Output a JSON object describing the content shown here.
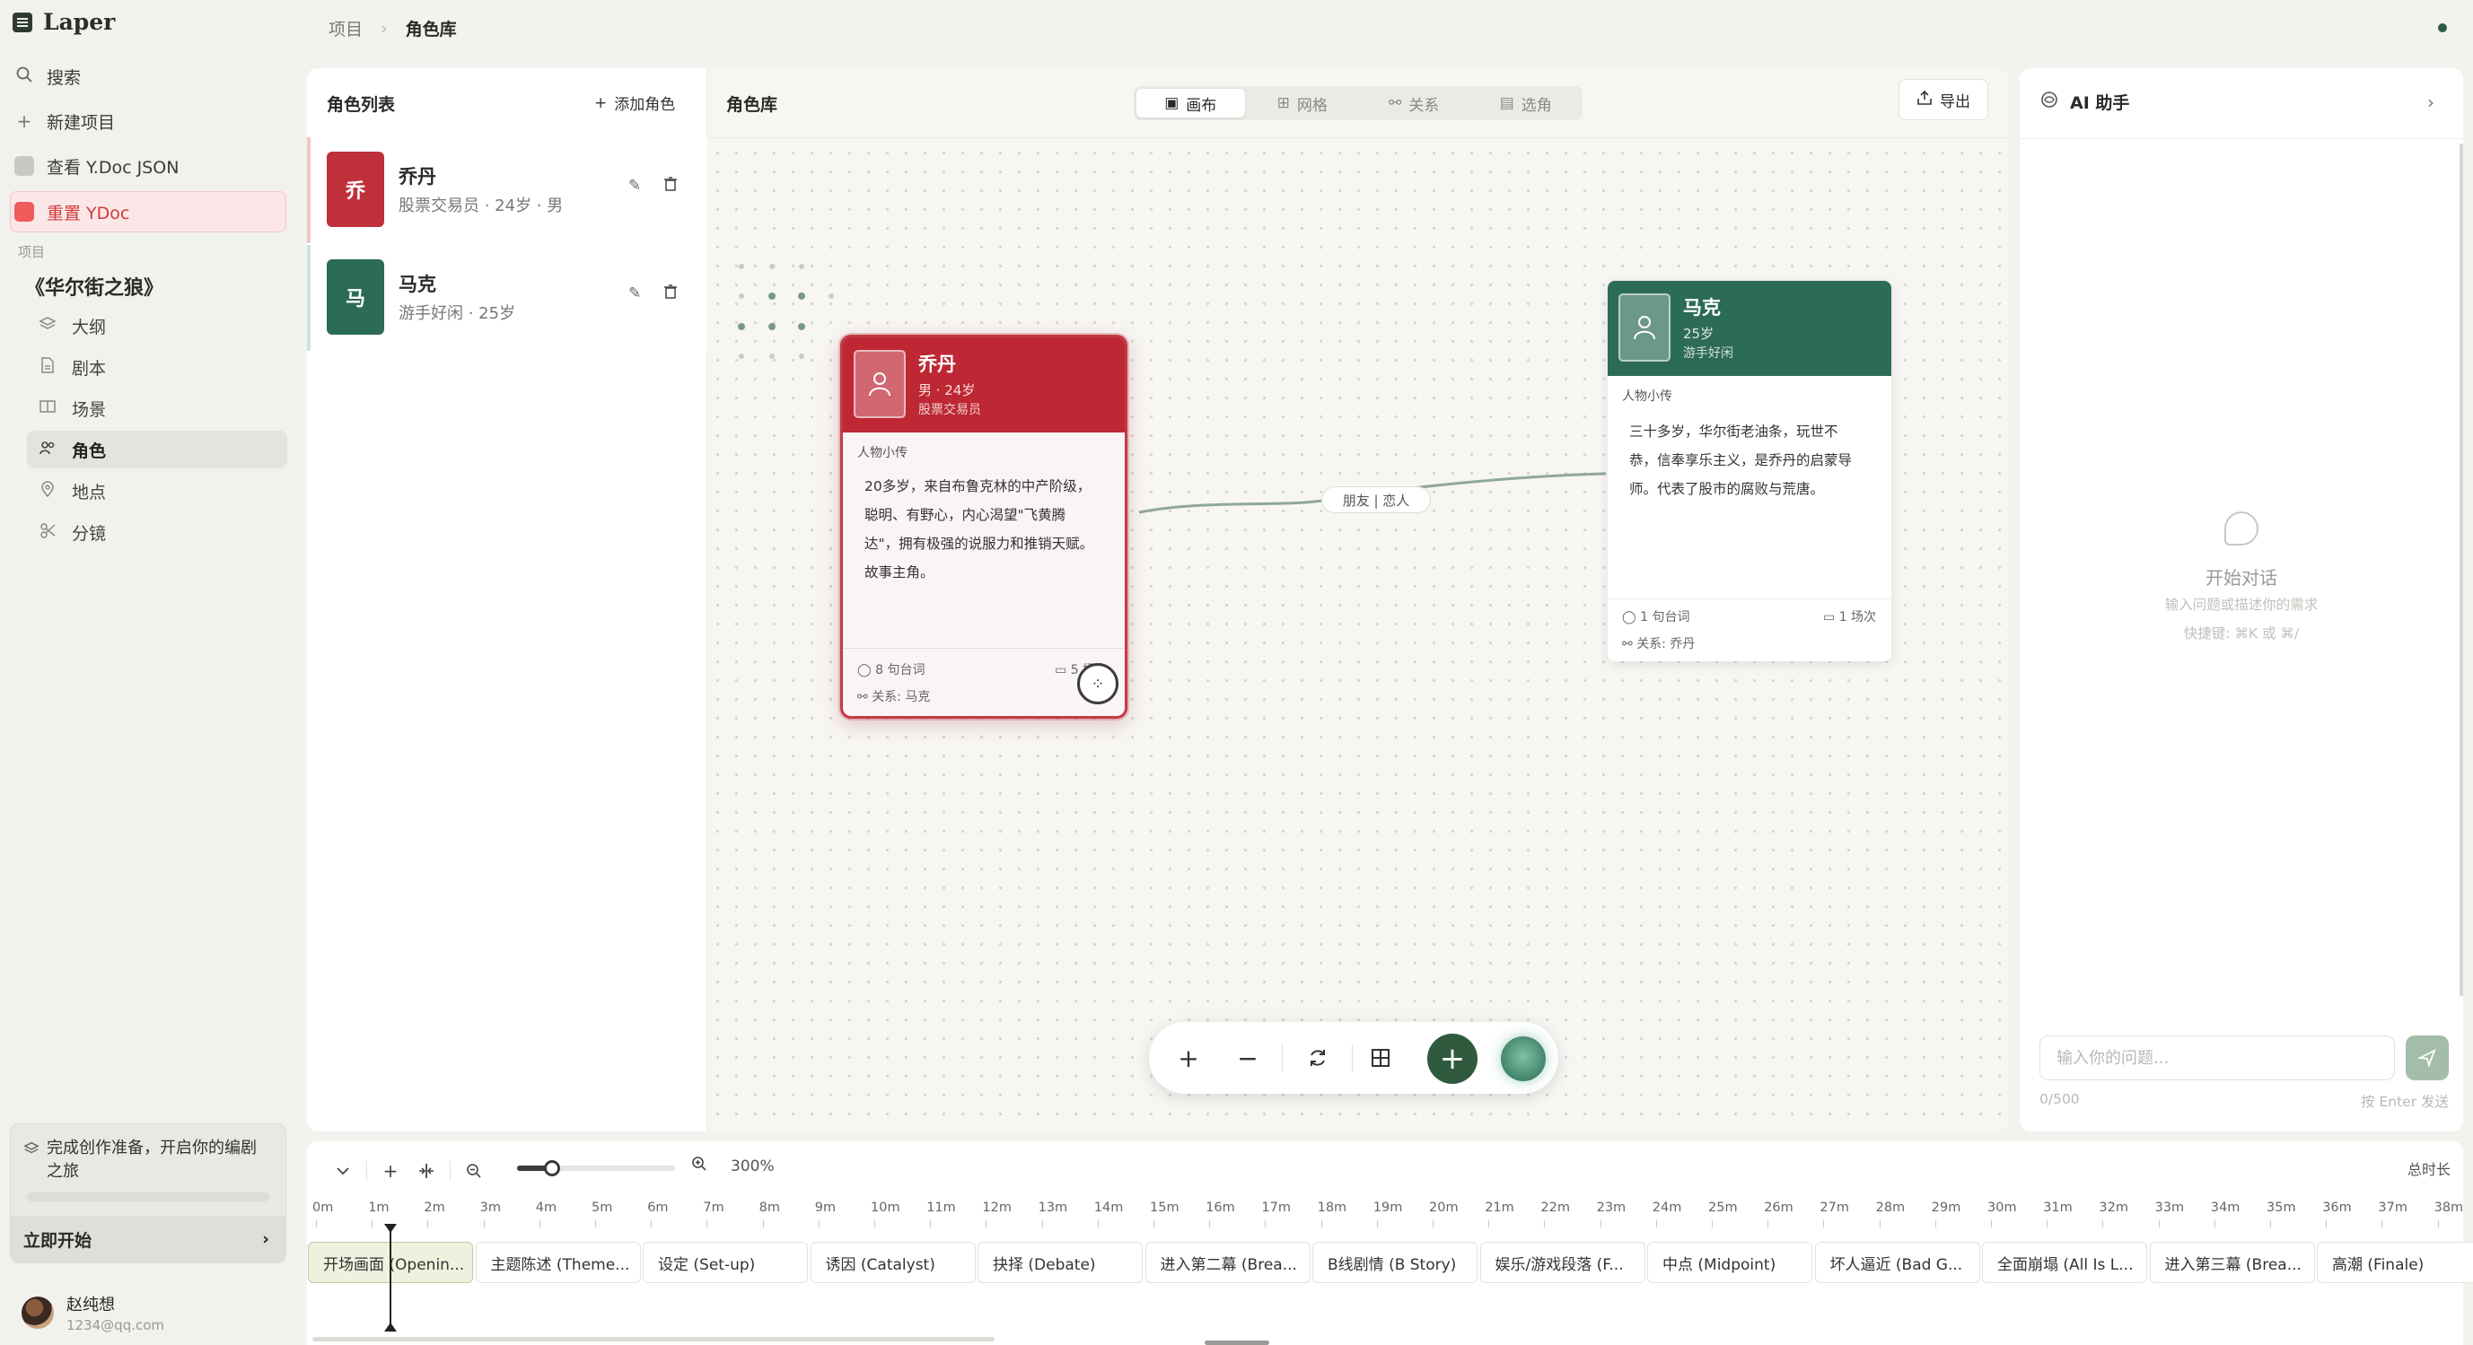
{
  "app": {
    "name": "Laper"
  },
  "sidebar": {
    "search": "搜索",
    "new_project": "新建项目",
    "view_ydoc": "查看 Y.Doc JSON",
    "reset_ydoc": "重置 YDoc",
    "section_label": "项目",
    "project_title": "《华尔街之狼》",
    "nav": [
      {
        "label": "大纲",
        "icon": "layers-icon"
      },
      {
        "label": "剧本",
        "icon": "file-icon"
      },
      {
        "label": "场景",
        "icon": "film-icon"
      },
      {
        "label": "角色",
        "icon": "users-icon"
      },
      {
        "label": "地点",
        "icon": "map-pin-icon"
      },
      {
        "label": "分镜",
        "icon": "storyboard-icon"
      }
    ],
    "tip": {
      "text": "完成创作准备，开启你的编剧之旅",
      "start": "立即开始"
    },
    "user": {
      "name": "赵纯想",
      "email": "1234@qq.com"
    }
  },
  "breadcrumb": {
    "root": "项目",
    "current": "角色库"
  },
  "list_panel": {
    "title": "角色列表",
    "add_label": "添加角色",
    "characters": [
      {
        "avatar": "乔",
        "name": "乔丹",
        "job": "股票交易员",
        "age": "24岁",
        "gender": "男",
        "color": "#c0303a"
      },
      {
        "avatar": "马",
        "name": "马克",
        "job": "游手好闲",
        "age": "25岁",
        "color": "#2d6b59"
      }
    ]
  },
  "canvas": {
    "title": "角色库",
    "tabs": [
      "画布",
      "网格",
      "关系",
      "选角"
    ],
    "active_tab": "画布",
    "export": "导出",
    "cards": {
      "jordan": {
        "name": "乔丹",
        "sub": "男 · 24岁",
        "job": "股票交易员",
        "bio_label": "人物小传",
        "bio": [
          "20多岁，来自布鲁克林的中产阶级，",
          "聪明、有野心，内心渴望\"飞黄腾",
          "达\"，拥有极强的说服力和推销天赋。",
          "故事主角。"
        ],
        "lines": "8 句台词",
        "scenes": "5 场次",
        "relation": "关系: 马克"
      },
      "mark": {
        "name": "马克",
        "age": "25岁",
        "job": "游手好闲",
        "bio_label": "人物小传",
        "bio": [
          "三十多岁，华尔街老油条，玩世不",
          "恭，信奉享乐主义，是乔丹的启蒙导",
          "师。代表了股市的腐败与荒唐。"
        ],
        "lines": "1 句台词",
        "scenes": "1 场次",
        "relation": "关系: 乔丹"
      }
    },
    "edge_label": "朋友 | 恋人"
  },
  "ai": {
    "title": "AI 助手",
    "empty_title": "开始对话",
    "empty_sub": "输入问题或描述你的需求",
    "shortcut": "快捷键: ⌘K 或 ⌘/",
    "placeholder": "输入你的问题...",
    "count": "0/500",
    "enter_hint": "按 Enter 发送"
  },
  "timeline": {
    "zoom": "300%",
    "total": "总时长",
    "ticks": [
      "0m",
      "1m",
      "2m",
      "3m",
      "4m",
      "5m",
      "6m",
      "7m",
      "8m",
      "9m",
      "10m",
      "11m",
      "12m",
      "13m",
      "14m",
      "15m",
      "16m",
      "17m",
      "18m",
      "19m",
      "20m",
      "21m",
      "22m",
      "23m",
      "24m",
      "25m",
      "26m",
      "27m",
      "28m",
      "29m",
      "30m",
      "31m",
      "32m",
      "33m",
      "34m",
      "35m",
      "36m",
      "37m",
      "38m"
    ],
    "beats": [
      "开场画面 (Openin...",
      "主题陈述 (Theme...",
      "设定 (Set-up)",
      "诱因 (Catalyst)",
      "抉择 (Debate)",
      "进入第二幕 (Brea...",
      "B线剧情 (B Story)",
      "娱乐/游戏段落 (F...",
      "中点 (Midpoint)",
      "坏人逼近 (Bad G...",
      "全面崩塌 (All Is L...",
      "进入第三幕 (Brea...",
      "高潮 (Finale)"
    ]
  },
  "colors": {
    "accent_green": "#2f5a3d",
    "jordan_red": "#be2734",
    "mark_green": "#2d6b59"
  }
}
